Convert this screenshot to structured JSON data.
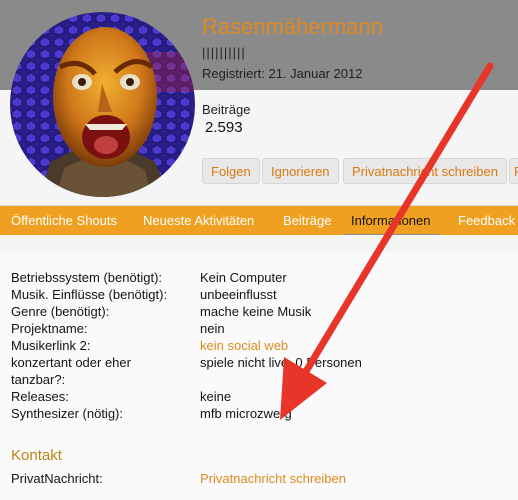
{
  "profile": {
    "username": "Rasenmähermann",
    "user_title": "||||||||||",
    "registered": "Registriert: 21. Januar 2012",
    "posts_label": "Beiträge",
    "posts_value": "2.593"
  },
  "actions": {
    "follow": "Folgen",
    "ignore": "Ignorieren",
    "message": "Privatnachricht schreiben",
    "more": "R"
  },
  "tabs": [
    {
      "label": "Öffentliche Shouts"
    },
    {
      "label": "Neueste Aktivitäten"
    },
    {
      "label": "Beiträge"
    },
    {
      "label": "Informationen"
    },
    {
      "label": "Feedback"
    }
  ],
  "info": {
    "rows": [
      {
        "label": "Betriebssystem (benötigt):",
        "value": "Kein Computer"
      },
      {
        "label": "Musik. Einflüsse (benötigt):",
        "value": "unbeeinflusst"
      },
      {
        "label": "Genre (benötigt):",
        "value": "mache keine Musik"
      },
      {
        "label": "Projektname:",
        "value": "nein"
      },
      {
        "label": "Musikerlink 2:",
        "value": "kein social web"
      },
      {
        "label": "konzertant oder eher",
        "value": "spiele nicht live, 0 Personen"
      },
      {
        "label": "tanzbar?:",
        "value": ""
      },
      {
        "label": "Releases:",
        "value": "keine"
      },
      {
        "label": "Synthesizer (nötig):",
        "value": "mfb microzwerg"
      }
    ]
  },
  "contact": {
    "title": "Kontakt",
    "label": "PrivatNachricht:",
    "value": "Privatnachricht schreiben"
  },
  "colors": {
    "accent": "#f0a020",
    "link": "#e08a1e",
    "arrow": "#e8352a"
  }
}
